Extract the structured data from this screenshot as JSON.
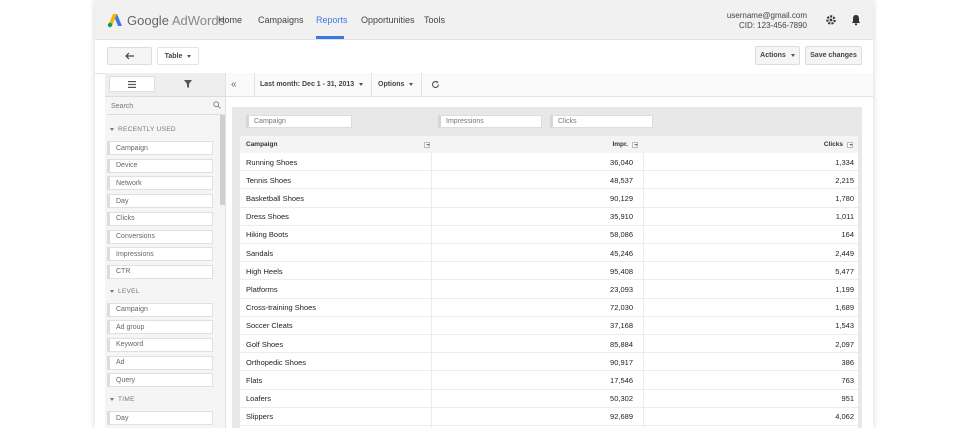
{
  "nav": {
    "logo_google": "Google",
    "logo_product": "AdWords",
    "links": [
      "Home",
      "Campaigns",
      "Reports",
      "Opportunities",
      "Tools"
    ],
    "active": "Reports",
    "accent_color": "#3b78e7",
    "email": "username@gmail.com",
    "cid": "CID: 123-456-7890",
    "icons": [
      "gear-icon",
      "bell-icon"
    ]
  },
  "toolbar": {
    "back_icon": "back-arrow-icon",
    "view_label": "Table",
    "actions_label": "Actions",
    "save_label": "Save changes"
  },
  "sidebar": {
    "search_placeholder": "Search",
    "sections": [
      {
        "title": "RECENTLY USED",
        "items": [
          "Campaign",
          "Device",
          "Network",
          "Day",
          "Clicks",
          "Conversions",
          "Impressions",
          "CTR"
        ]
      },
      {
        "title": "LEVEL",
        "items": [
          "Campaign",
          "Ad group",
          "Keyword",
          "Ad",
          "Query"
        ]
      },
      {
        "title": "TIME",
        "items": [
          "Day"
        ]
      }
    ]
  },
  "report_bar": {
    "date_range": "Last month: Dec 1 - 31, 2013",
    "options_label": "Options"
  },
  "filters": [
    "Campaign",
    "Impressions",
    "Clicks"
  ],
  "table": {
    "columns": [
      "Campaign",
      "Impr.",
      "Clicks"
    ],
    "rows": [
      [
        "Running Shoes",
        "36,040",
        "1,334"
      ],
      [
        "Tennis Shoes",
        "48,537",
        "2,215"
      ],
      [
        "Basketball Shoes",
        "90,129",
        "1,780"
      ],
      [
        "Dress Shoes",
        "35,910",
        "1,011"
      ],
      [
        "Hiking Boots",
        "58,086",
        "164"
      ],
      [
        "Sandals",
        "45,246",
        "2,449"
      ],
      [
        "High Heels",
        "95,408",
        "5,477"
      ],
      [
        "Platforms",
        "23,093",
        "1,199"
      ],
      [
        "Cross-training Shoes",
        "72,030",
        "1,689"
      ],
      [
        "Soccer Cleats",
        "37,168",
        "1,543"
      ],
      [
        "Golf Shoes",
        "85,884",
        "2,097"
      ],
      [
        "Orthopedic Shoes",
        "90,917",
        "386"
      ],
      [
        "Flats",
        "17,546",
        "763"
      ],
      [
        "Loafers",
        "50,302",
        "951"
      ],
      [
        "Slippers",
        "92,689",
        "4,062"
      ]
    ]
  }
}
